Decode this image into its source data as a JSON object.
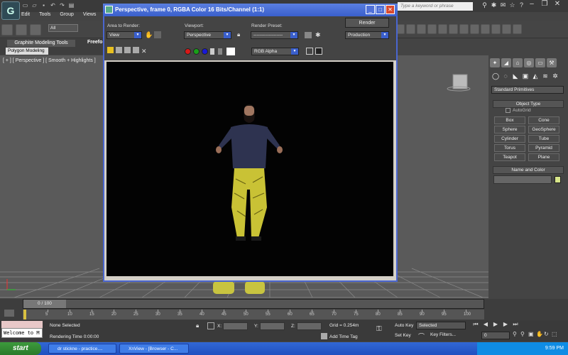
{
  "app": {
    "menu": [
      "Edit",
      "Tools",
      "Group",
      "Views"
    ],
    "search_placeholder": "Type a keyword or phrase",
    "selection_filter": "All"
  },
  "ribbon": {
    "tab_graphite": "Graphite Modeling Tools",
    "tab_freeform": "Freefo",
    "sub_polygon": "Polygon Modeling"
  },
  "viewport": {
    "label": "[ + ] [ Perspective ] [ Smooth + Highlights ]"
  },
  "render_window": {
    "title": "Perspective, frame 0, RGBA Color 16 Bits/Channel (1:1)",
    "area_label": "Area to Render:",
    "area_value": "View",
    "viewport_label": "Viewport:",
    "viewport_value": "Perspective",
    "preset_label": "Render Preset:",
    "preset_value": "-------------------",
    "render_button": "Render",
    "production_value": "Production",
    "channel_value": "RGB Alpha",
    "colors": {
      "red": "#d81818",
      "green": "#18a018",
      "blue": "#1818d8"
    }
  },
  "command_panel": {
    "primitive_type": "Standard Primitives",
    "object_type_header": "Object Type",
    "autogrid_label": "AutoGrid",
    "objects": [
      "Box",
      "Cone",
      "Sphere",
      "GeoSphere",
      "Cylinder",
      "Tube",
      "Torus",
      "Pyramid",
      "Teapot",
      "Plane"
    ],
    "name_color_header": "Name and Color",
    "object_color": "#d8e68a"
  },
  "timeline": {
    "frame_display": "0 / 100",
    "ticks": [
      "0",
      "5",
      "10",
      "15",
      "20",
      "25",
      "30",
      "35",
      "40",
      "45",
      "50",
      "55",
      "60",
      "65",
      "70",
      "75",
      "80",
      "85",
      "90",
      "95",
      "100"
    ]
  },
  "status": {
    "welcome": "Welcome to M",
    "selection": "None Selected",
    "render_time": "Rendering Time  0:00:00",
    "x_label": "X:",
    "y_label": "Y:",
    "z_label": "Z:",
    "grid": "Grid = 0.254m",
    "add_time_tag": "Add Time Tag",
    "auto_key": "Auto Key",
    "set_key": "Set Key",
    "selected_value": "Selected",
    "key_filters": "Key Filters...",
    "current_frame": "0"
  },
  "taskbar": {
    "start": "start",
    "items": [
      "dr stickne - practice....",
      "XnView - [Browser - C..."
    ],
    "clock": "9:59 PM"
  }
}
